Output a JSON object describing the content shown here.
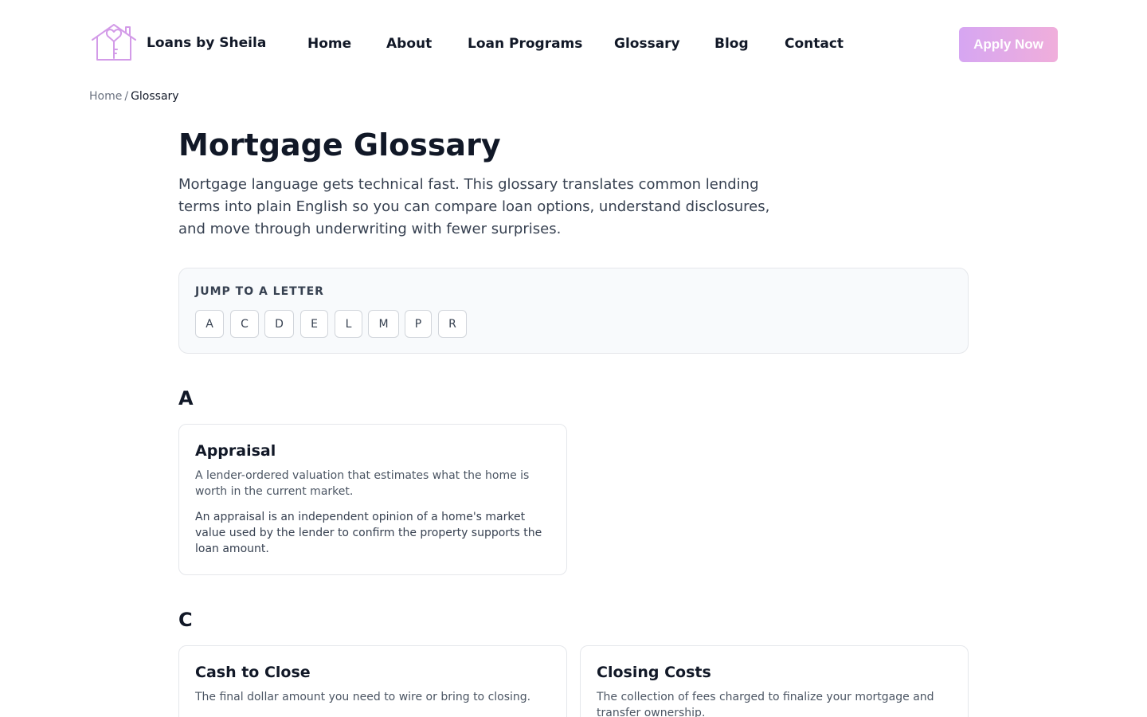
{
  "brand": {
    "name": "Loans by Sheila",
    "logo_icon": "house-key-icon"
  },
  "nav": {
    "items": [
      {
        "label": "Home"
      },
      {
        "label": "About"
      },
      {
        "label": "Loan Programs"
      },
      {
        "label": "Glossary"
      },
      {
        "label": "Blog"
      },
      {
        "label": "Contact"
      }
    ],
    "cta": "Apply Now"
  },
  "breadcrumb": {
    "home": "Home",
    "separator": "/",
    "current": "Glossary"
  },
  "page": {
    "title": "Mortgage Glossary",
    "intro": "Mortgage language gets technical fast. This glossary translates common lending terms into plain English so you can compare loan options, understand disclosures, and move through underwriting with fewer surprises."
  },
  "jump": {
    "label": "JUMP TO A LETTER",
    "letters": [
      "A",
      "C",
      "D",
      "E",
      "L",
      "M",
      "P",
      "R"
    ]
  },
  "sections": [
    {
      "letter": "A",
      "terms": [
        {
          "title": "Appraisal",
          "short": "A lender-ordered valuation that estimates what the home is worth in the current market.",
          "long": "An appraisal is an independent opinion of a home's market value used by the lender to confirm the property supports the loan amount."
        }
      ]
    },
    {
      "letter": "C",
      "terms": [
        {
          "title": "Cash to Close",
          "short": "The final dollar amount you need to wire or bring to closing."
        },
        {
          "title": "Closing Costs",
          "short": "The collection of fees charged to finalize your mortgage and transfer ownership."
        }
      ]
    }
  ],
  "colors": {
    "text": "#111827",
    "muted": "#6b7280",
    "cta_gradient_start": "#d6a6f2",
    "cta_gradient_end": "#f0aedb",
    "logo": "#d39be8"
  }
}
